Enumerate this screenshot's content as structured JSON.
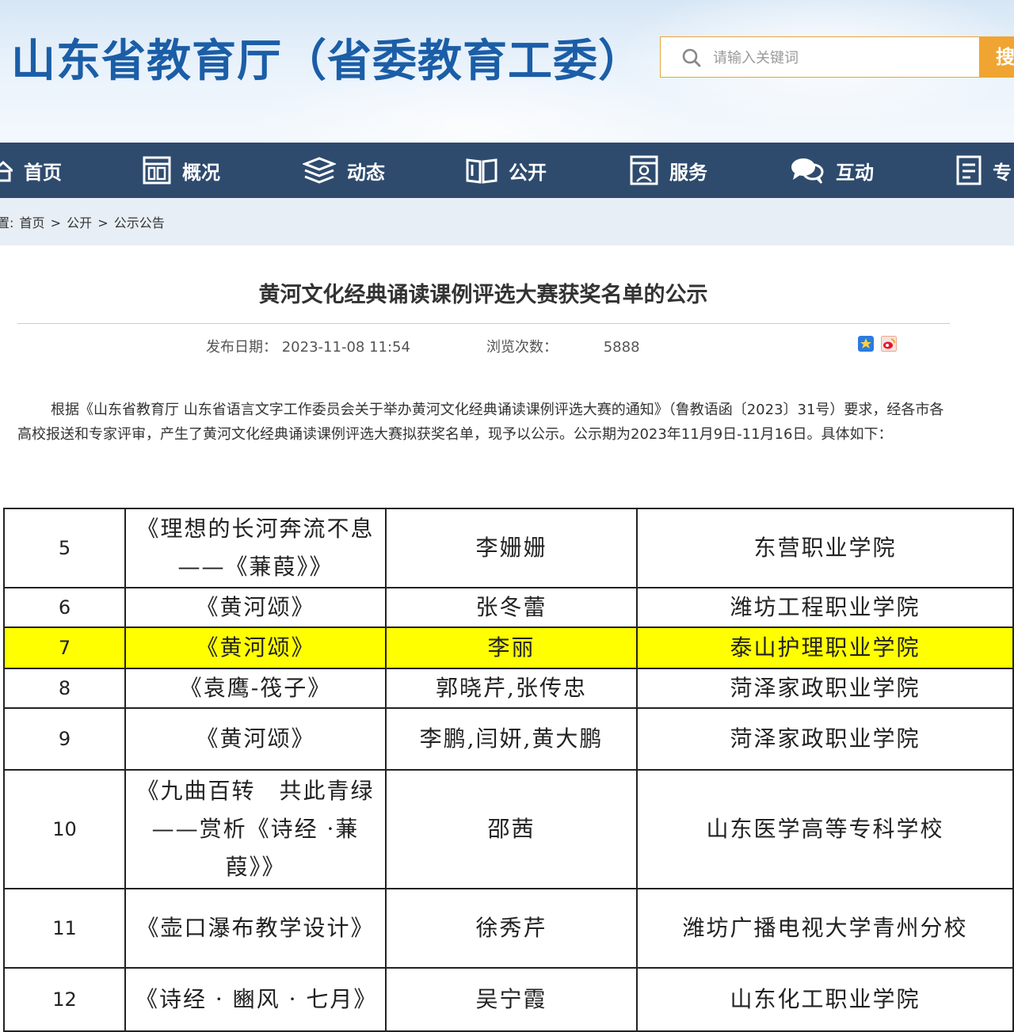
{
  "header": {
    "site_title": "山东省教育厅（省委教育工委）",
    "search_placeholder": "请输入关键词",
    "search_button": "搜"
  },
  "nav": {
    "items": [
      {
        "label": "首页",
        "icon": "home-icon"
      },
      {
        "label": "概况",
        "icon": "overview-icon"
      },
      {
        "label": "动态",
        "icon": "news-icon"
      },
      {
        "label": "公开",
        "icon": "book-icon"
      },
      {
        "label": "服务",
        "icon": "service-icon"
      },
      {
        "label": "互动",
        "icon": "chat-icon"
      },
      {
        "label": "专",
        "icon": "doc-icon"
      }
    ]
  },
  "breadcrumb": {
    "prefix": "置:",
    "items": [
      "首页",
      ">",
      "公开",
      ">",
      "公示公告"
    ]
  },
  "article": {
    "title": "黄河文化经典诵读课例评选大赛获奖名单的公示",
    "publish_label": "发布日期：",
    "publish_date": "2023-11-08 11:54",
    "views_label": "浏览次数：",
    "views": "5888",
    "share_icons": [
      "qzone-icon",
      "weibo-icon"
    ],
    "intro": "根据《山东省教育厅 山东省语言文字工作委员会关于举办黄河文化经典诵读课例评选大赛的通知》（鲁教语函〔2023〕31号）要求，经各市各高校报送和专家评审，产生了黄河文化经典诵读课例评选大赛拟获奖名单，现予以公示。公示期为2023年11月9日-11月16日。具体如下："
  },
  "table": {
    "highlight_color": "#ffff00",
    "rows": [
      {
        "no": "5",
        "title": "《理想的长河奔流不息 ——《蒹葭》》",
        "author": "李姗姗",
        "school": "东营职业学院"
      },
      {
        "no": "6",
        "title": "《黄河颂》",
        "author": "张冬蕾",
        "school": "潍坊工程职业学院"
      },
      {
        "no": "7",
        "title": "《黄河颂》",
        "author": "李丽",
        "school": "泰山护理职业学院",
        "highlighted": true
      },
      {
        "no": "8",
        "title": "《袁鹰-筏子》",
        "author": "郭晓芹,张传忠",
        "school": "菏泽家政职业学院"
      },
      {
        "no": "9",
        "title": "《黄河颂》",
        "author": "李鹏,闫妍,黄大鹏",
        "school": "菏泽家政职业学院"
      },
      {
        "no": "10",
        "title": "《九曲百转　共此青绿——赏析《诗经 ·蒹葭》》",
        "author": "邵茜",
        "school": "山东医学高等专科学校"
      },
      {
        "no": "11",
        "title": "《壶口瀑布教学设计》",
        "author": "徐秀芹",
        "school": "潍坊广播电视大学青州分校"
      },
      {
        "no": "12",
        "title": "《诗经 · 豳风 · 七月》",
        "author": "吴宁霞",
        "school": "山东化工职业学院"
      }
    ]
  }
}
